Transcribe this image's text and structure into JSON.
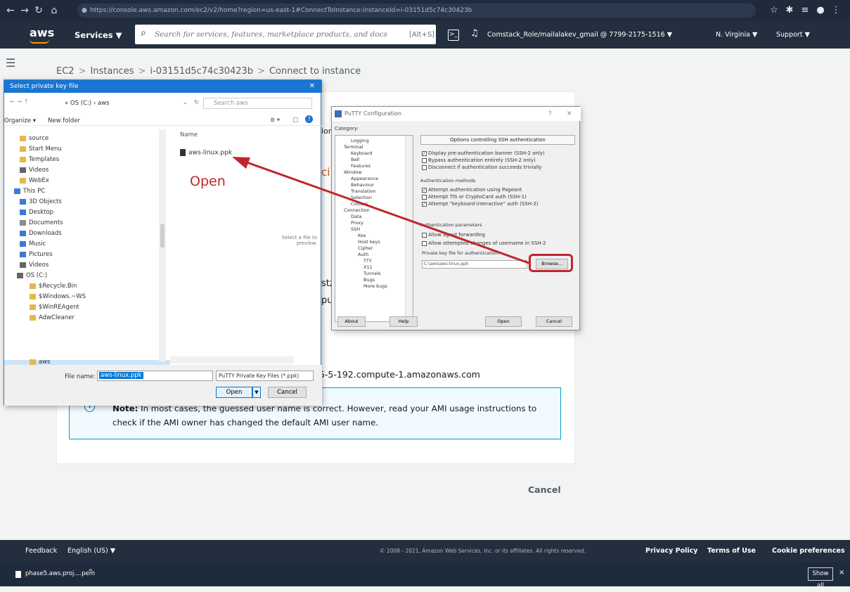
{
  "browser": {
    "url": "https://console.aws.amazon.com/ec2/v2/home?region=us-east-1#ConnectToInstance:instanceId=i-03151d5c74c30423b"
  },
  "aws_nav": {
    "logo": "aws",
    "services_label": "Services ▼",
    "search_placeholder": "Search for services, features, marketplace products, and docs",
    "search_shortcut": "[Alt+S]",
    "account": "Comstack_Role/mailalakev_gmail @ 7799-2175-1516 ▼",
    "region": "N. Virginia ▼",
    "support": "Support ▼"
  },
  "breadcrumb": [
    "EC2",
    "Instances",
    "i-03151d5c74c30423b",
    "Connect to instance"
  ],
  "main": {
    "hostname": "35-5-192.compute-1.amazonaws.com",
    "peek_1": "ion",
    "peek_2": "ci",
    "peek_3": "stz",
    "peek_4": "pu",
    "note_label": "Note:",
    "note_text": "In most cases, the guessed user name is correct. However, read your AMI usage instructions to check if the AMI owner has changed the default AMI user name.",
    "cancel": "Cancel"
  },
  "file_dialog": {
    "title": "Select private key file",
    "address": "« OS (C:) › aws",
    "search_placeholder": "Search aws",
    "organize": "Organize ▾",
    "new_folder": "New folder",
    "name_header": "Name",
    "file_item": "aws-linux.ppk",
    "preview_text": "Select a file to preview.",
    "tree": [
      "source",
      "Start Menu",
      "Templates",
      "Videos",
      "WebEx",
      "This PC",
      "3D Objects",
      "Desktop",
      "Documents",
      "Downloads",
      "Music",
      "Pictures",
      "Videos",
      "OS (C:)",
      "$Recycle.Bin",
      "$Windows.~WS",
      "$WinREAgent",
      "AdwCleaner",
      "aws"
    ],
    "file_name_label": "File name:",
    "file_name_value": "aws-linux.ppk",
    "file_type": "PuTTY Private Key Files (*.ppk)",
    "open_btn": "Open",
    "cancel_btn": "Cancel"
  },
  "annotation": {
    "text": "Open",
    "color": "#c0272d"
  },
  "putty": {
    "title": "PuTTY Configuration",
    "category_label": "Category:",
    "tree": [
      "Logging",
      "Terminal",
      "Keyboard",
      "Bell",
      "Features",
      "Window",
      "Appearance",
      "Behaviour",
      "Translation",
      "Selection",
      "Colours",
      "Connection",
      "Data",
      "Proxy",
      "SSH",
      "Kex",
      "Host keys",
      "Cipher",
      "Auth",
      "TTY",
      "X11",
      "Tunnels",
      "Bugs",
      "More bugs"
    ],
    "header": "Options controlling SSH authentication",
    "chk_banner": "Display pre-authentication banner (SSH-2 only)",
    "chk_bypass": "Bypass authentication entirely (SSH-2 only)",
    "chk_disconnect": "Disconnect if authentication succeeds trivially",
    "group_methods": "Authentication methods",
    "chk_pageant": "Attempt authentication using Pageant",
    "chk_tis": "Attempt TIS or CryptoCard auth (SSH-1)",
    "chk_keyboard": "Attempt \"keyboard-interactive\" auth (SSH-2)",
    "group_params": "Authentication parameters",
    "chk_forwarding": "Allow agent forwarding",
    "chk_username": "Allow attempted changes of username in SSH-2",
    "key_label": "Private key file for authentication:",
    "key_value": "C:\\aws\\aws-linux.ppk",
    "browse": "Browse...",
    "about": "About",
    "help": "Help",
    "open": "Open",
    "cancel": "Cancel"
  },
  "footer": {
    "feedback": "Feedback",
    "language": "English (US) ▼",
    "copyright": "© 2008 - 2021, Amazon Web Services, Inc. or its affiliates. All rights reserved.",
    "privacy": "Privacy Policy",
    "terms": "Terms of Use",
    "cookies": "Cookie preferences"
  },
  "downloads": {
    "file": "phase5.aws.proj....pem",
    "show_all": "Show all"
  }
}
